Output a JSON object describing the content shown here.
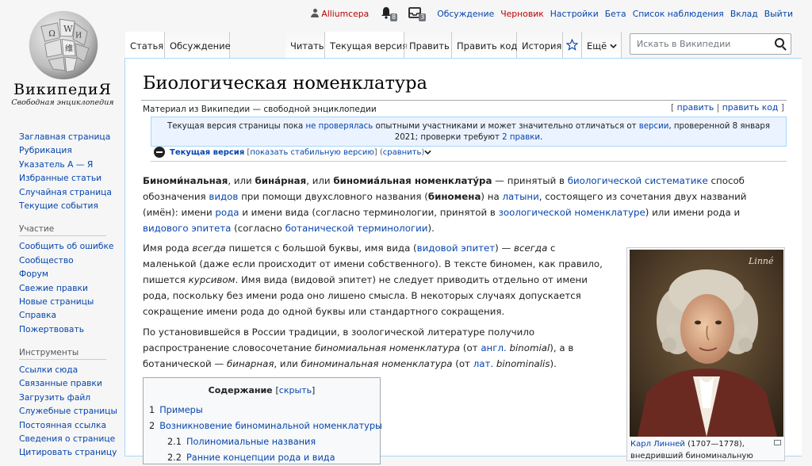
{
  "logo": {
    "wordmark": "ВикипедиЯ",
    "tagline": "Свободная энциклопедия"
  },
  "personal": {
    "username": "Alliumcepa",
    "alerts_count": "8",
    "notices_count": "3",
    "links": [
      "Обсуждение",
      "Черновик",
      "Настройки",
      "Бета",
      "Список наблюдения",
      "Вклад",
      "Выйти"
    ]
  },
  "sidebar": {
    "main": [
      "Заглавная страница",
      "Рубрикация",
      "Указатель А — Я",
      "Избранные статьи",
      "Случайная страница",
      "Текущие события"
    ],
    "participation_title": "Участие",
    "participation": [
      "Сообщить об ошибке",
      "Сообщество",
      "Форум",
      "Свежие правки",
      "Новые страницы",
      "Справка",
      "Пожертвовать"
    ],
    "tools_title": "Инструменты",
    "tools": [
      "Ссылки сюда",
      "Связанные правки",
      "Загрузить файл",
      "Служебные страницы",
      "Постоянная ссылка",
      "Сведения о странице",
      "Цитировать страницу"
    ]
  },
  "tabs": {
    "article": "Статья",
    "talk": "Обсуждение",
    "read": "Читать",
    "current": "Текущая версия",
    "edit": "Править",
    "edit_source": "Править код",
    "history": "История",
    "more": "Ещё"
  },
  "search": {
    "placeholder": "Искать в Википедии"
  },
  "article": {
    "title": "Биологическая номенклатура",
    "subtitle": "Материал из Википедии — свободной энциклопедии",
    "edit_links": {
      "edit": "править",
      "edit_source": "править код"
    },
    "flagged": {
      "t1": "Текущая версия страницы пока ",
      "l1": "не проверялась",
      "t2": " опытными участниками и может значительно отличаться от ",
      "l2": "версии",
      "t3": ", проверенной 8 января 2021; проверки требуют ",
      "l3": "2 правки",
      "t4": "."
    },
    "revision": {
      "current": "Текущая версия",
      "show_stable": "показать стабильную версию",
      "diff": "сравнить"
    },
    "p1": {
      "b1": "Биноми́нальная",
      "t1": ", или ",
      "b2": "бина́рная",
      "t2": ", или ",
      "b3": "биномиа́льная номенклату́ра",
      "t3": " — принятый в ",
      "l1": "биологической систематике",
      "t4": " способ обозначения ",
      "l2": "видов",
      "t5": " при помощи двухсловного названия (",
      "b4": "биномена",
      "t6": ") на ",
      "l3": "латыни",
      "t7": ", состоящего из сочетания двух названий (имён): имени ",
      "l4": "рода",
      "t8": " и имени вида (согласно терминологии, принятой в ",
      "l5": "зоологической номенклатуре",
      "t9": ") или имени рода и ",
      "l6": "видового эпитета",
      "t10": " (согласно ",
      "l7": "ботанической терминологии",
      "t11": ")."
    },
    "p2": {
      "t1": "Имя рода ",
      "i1": "всегда",
      "t2": " пишется с большой буквы, имя вида (",
      "l1": "видовой эпитет",
      "t3": ") — ",
      "i2": "всегда",
      "t4": " с маленькой (даже если происходит от имени собственного). В тексте биномен, как правило, пишется ",
      "i3": "курсивом",
      "t5": ". Имя вида (видовой эпитет) не следует приводить отдельно от имени рода, поскольку без имени рода оно лишено смысла. В некоторых случаях допускается сокращение имени рода до одной буквы или стандартного сокращения."
    },
    "p3": {
      "t1": "По установившейся в России традиции, в зоологической литературе получило распространение словосочетание ",
      "i1": "биномиальная номенклатура",
      "t2": " (от ",
      "l1": "англ.",
      "i2": " binomial",
      "t3": "), а в ботанической — ",
      "i3": "бинарная",
      "t4": ", или ",
      "i4": "биноминальная номенклатура",
      "t5": " (от ",
      "l2": "лат.",
      "i5": " binominalis",
      "t6": ")."
    },
    "toc": {
      "title": "Содержание",
      "hide": "скрыть",
      "items": [
        {
          "num": "1",
          "label": "Примеры"
        },
        {
          "num": "2",
          "label": "Возникновение биноминальной номенклатуры"
        },
        {
          "num": "2.1",
          "label": "Полиномиальные названия"
        },
        {
          "num": "2.2",
          "label": "Ранние концепции рода и вида"
        }
      ]
    },
    "thumb": {
      "signature": "Linné",
      "caption_link": "Карл Линней",
      "caption_text": " (1707—1778), внедривший биноминальную"
    }
  },
  "colors": {
    "link": "#0645ad",
    "red_link": "#ba0000",
    "border": "#a7d7f9",
    "flagged_bg": "#eaf3ff"
  }
}
